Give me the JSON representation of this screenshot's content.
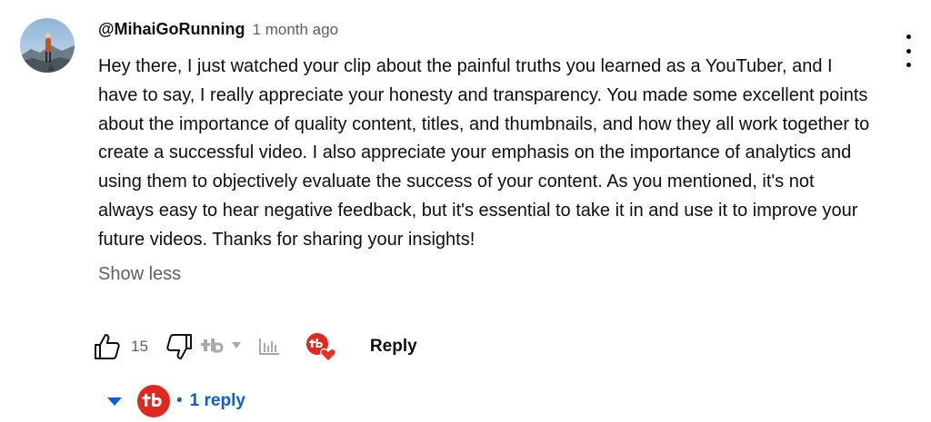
{
  "comment": {
    "author": "@MihaiGoRunning",
    "timestamp": "1 month ago",
    "text": "Hey there, I just watched your clip about the painful truths you learned as a YouTuber, and I have to say, I really appreciate your honesty and transparency. You made some excellent points about the importance of quality content, titles, and thumbnails, and how they all work together to create a successful video. I also appreciate your emphasis on the importance of analytics and using them to objectively evaluate the success of your content. As you mentioned, it's not always easy to hear negative feedback, but it's essential to take it in and use it to improve your future videos. Thanks for sharing your insights!",
    "show_less_label": "Show less"
  },
  "actions": {
    "like_count": "15",
    "reply_label": "Reply",
    "icons": [
      "thumbs-up-icon",
      "thumbs-down-icon",
      "tubebuddy-logo-icon",
      "caret-down-icon",
      "analytics-icon",
      "creator-heart-icon"
    ]
  },
  "replies": {
    "expand_icon": "caret-down-icon",
    "separator": "•",
    "label": "1 reply"
  },
  "colors": {
    "text": "#0f0f0f",
    "secondary": "#606060",
    "link_blue": "#065fd4",
    "tubebuddy_red": "#e0281e",
    "heart_red": "#e6322b"
  }
}
